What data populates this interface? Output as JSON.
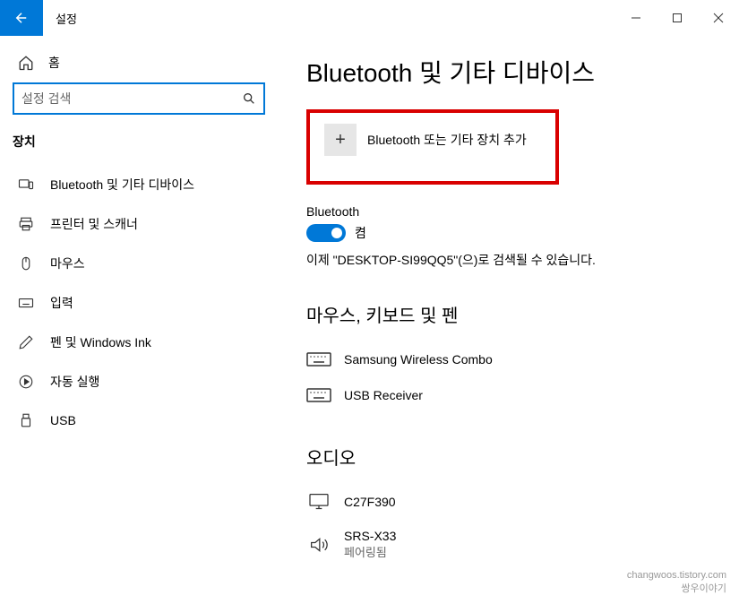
{
  "titlebar": {
    "app_title": "설정"
  },
  "sidebar": {
    "home_label": "홈",
    "search_placeholder": "설정 검색",
    "category": "장치",
    "items": [
      {
        "label": "Bluetooth 및 기타 디바이스"
      },
      {
        "label": "프린터 및 스캐너"
      },
      {
        "label": "마우스"
      },
      {
        "label": "입력"
      },
      {
        "label": "펜 및 Windows Ink"
      },
      {
        "label": "자동 실행"
      },
      {
        "label": "USB"
      }
    ]
  },
  "content": {
    "page_title": "Bluetooth 및 기타 디바이스",
    "add_device_label": "Bluetooth 또는 기타 장치 추가",
    "bluetooth_label": "Bluetooth",
    "toggle_state": "켬",
    "discoverable_text": "이제 \"DESKTOP-SI99QQ5\"(으)로 검색될 수 있습니다.",
    "section_mouse_title": "마우스, 키보드 및 펜",
    "mouse_devices": [
      {
        "name": "Samsung Wireless Combo"
      },
      {
        "name": "USB Receiver"
      }
    ],
    "section_audio_title": "오디오",
    "audio_devices": [
      {
        "name": "C27F390",
        "status": ""
      },
      {
        "name": "SRS-X33",
        "status": "페어링됨"
      }
    ]
  },
  "watermark": {
    "line1": "changwoos.tistory.com",
    "line2": "쌍우이야기"
  }
}
